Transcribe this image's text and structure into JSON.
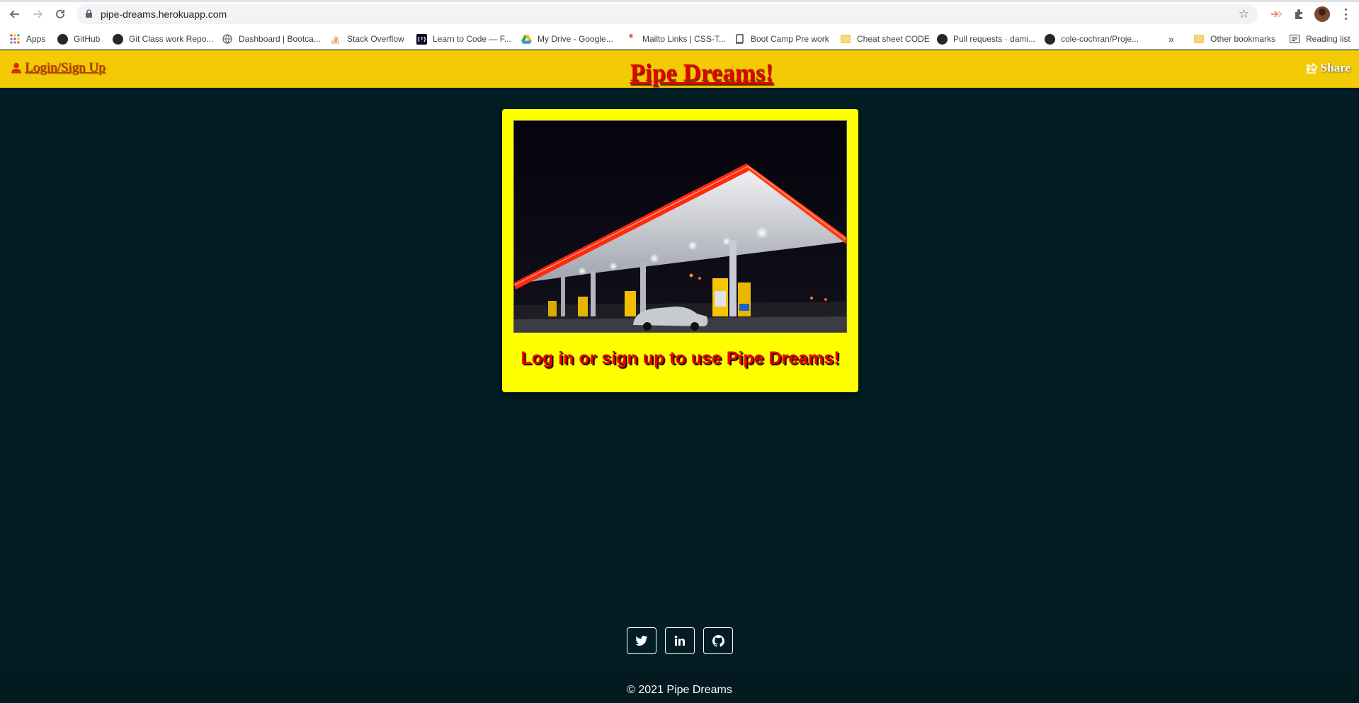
{
  "browser": {
    "url": "pipe-dreams.herokuapp.com",
    "bookmarks": [
      {
        "label": "Apps",
        "icon": "apps-grid-icon"
      },
      {
        "label": "GitHub",
        "icon": "github-icon"
      },
      {
        "label": "Git Class work Repo...",
        "icon": "github-icon"
      },
      {
        "label": "Dashboard | Bootca...",
        "icon": "globe-icon"
      },
      {
        "label": "Stack Overflow",
        "icon": "stackoverflow-icon"
      },
      {
        "label": "Learn to Code — F...",
        "icon": "freecodecamp-icon"
      },
      {
        "label": "My Drive - Google...",
        "icon": "google-drive-icon"
      },
      {
        "label": "Mailto Links | CSS-T...",
        "icon": "css-tricks-icon"
      },
      {
        "label": "Boot Camp Pre work",
        "icon": "book-icon"
      },
      {
        "label": "Cheat sheet CODE",
        "icon": "folder-icon"
      },
      {
        "label": "Pull requests · dami...",
        "icon": "github-icon"
      },
      {
        "label": "cole-cochran/Proje...",
        "icon": "github-icon"
      }
    ],
    "overflow": "»",
    "other_bookmarks": "Other bookmarks",
    "reading_list": "Reading list"
  },
  "header": {
    "login_label": "Login/Sign Up",
    "title": "Pipe Dreams!",
    "share_label": "Share"
  },
  "card": {
    "message": "Log in or sign up to use Pipe Dreams!",
    "image_desc": "gas-station-night-photo"
  },
  "social": [
    "twitter-icon",
    "linkedin-icon",
    "github-icon"
  ],
  "footer": {
    "copyright": "© 2021 Pipe Dreams"
  },
  "colors": {
    "header_bg": "#f2cb05",
    "page_bg": "#021d24",
    "card_bg": "#ffff00",
    "accent_red": "#e60000"
  }
}
